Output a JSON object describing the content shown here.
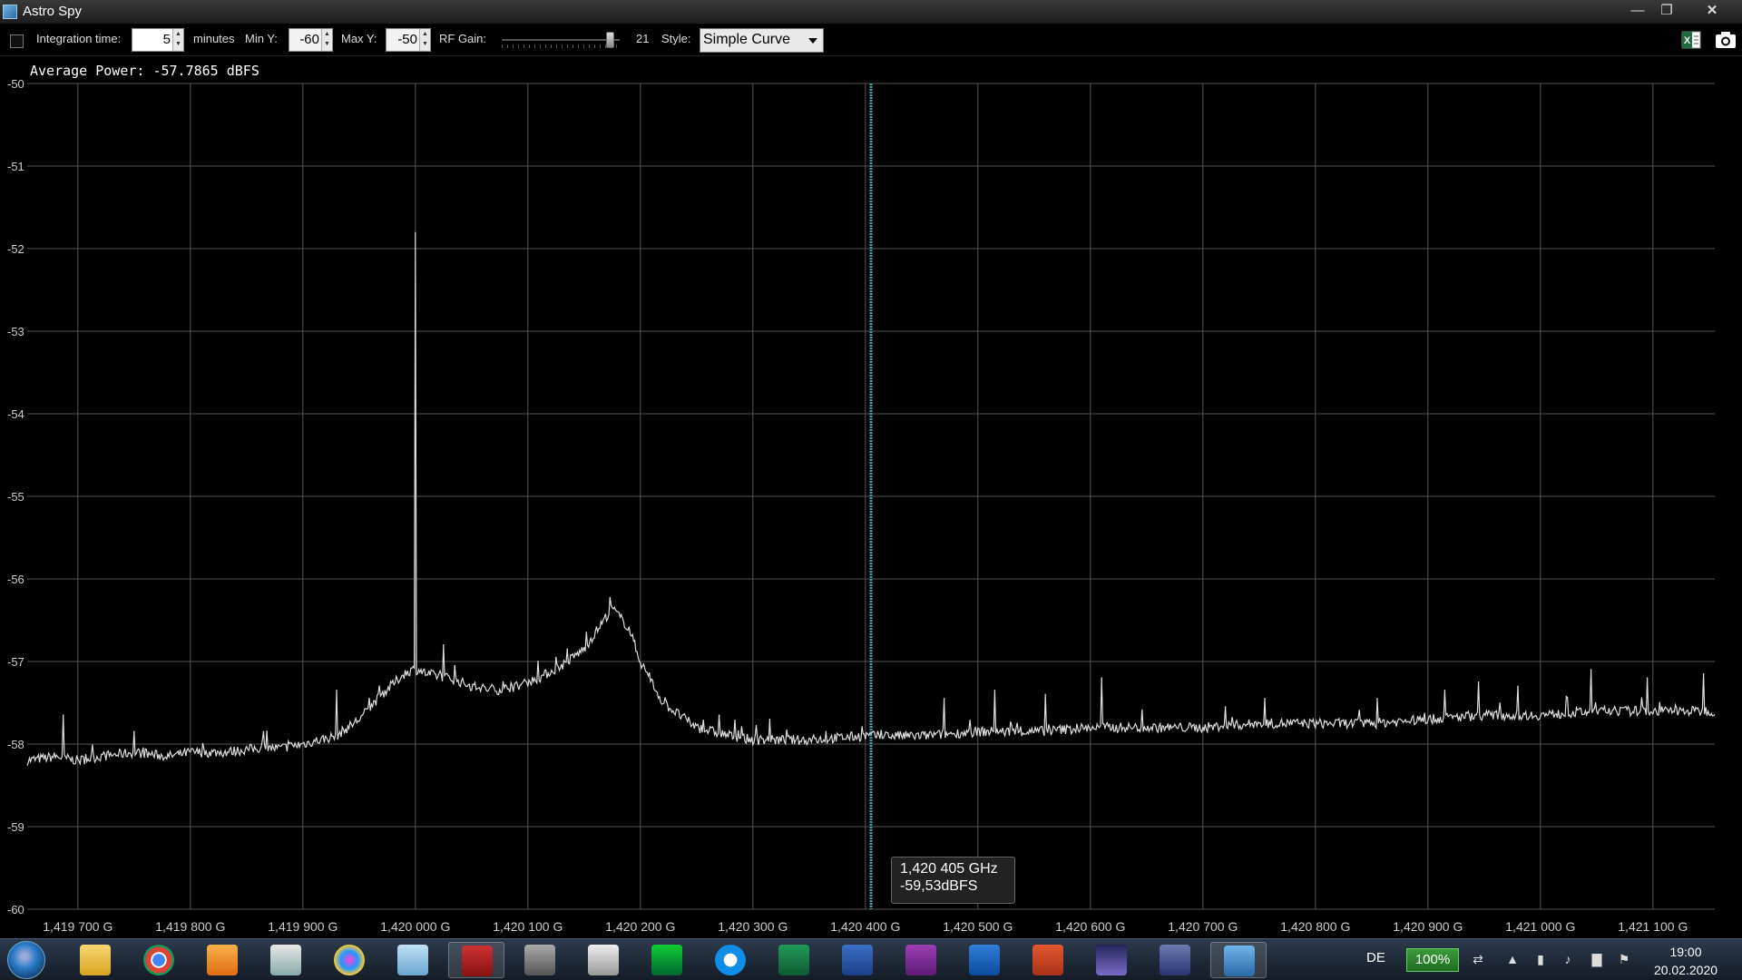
{
  "window": {
    "title": "Astro Spy"
  },
  "toolbar": {
    "integration_label": "Integration time:",
    "integration_value": "5",
    "minutes_label": "minutes",
    "min_y_label": "Min Y:",
    "min_y_value": "-60",
    "max_y_label": "Max Y:",
    "max_y_value": "-50",
    "rf_gain_label": "RF Gain:",
    "rf_gain_value": "21",
    "rf_gain_fraction": 0.95,
    "style_label": "Style:",
    "style_value": "Simple Curve"
  },
  "chart": {
    "average_power": "Average Power: -57.7865 dBFS",
    "tooltip_freq": "1,420 405 GHz",
    "tooltip_power": "-59,53dBFS"
  },
  "chart_data": {
    "type": "line",
    "title": "",
    "xlabel": "",
    "ylabel": "",
    "xlim": [
      1419.655,
      1421.155
    ],
    "ylim": [
      -60,
      -50
    ],
    "x_unit": "MHz",
    "x_ticks": [
      1419.7,
      1419.8,
      1419.9,
      1420.0,
      1420.1,
      1420.2,
      1420.3,
      1420.4,
      1420.5,
      1420.6,
      1420.7,
      1420.8,
      1420.9,
      1421.0,
      1421.1
    ],
    "x_tick_labels": [
      "1,419 700 G",
      "1,419 800 G",
      "1,419 900 G",
      "1,420 000 G",
      "1,420 100 G",
      "1,420 200 G",
      "1,420 300 G",
      "1,420 400 G",
      "1,420 500 G",
      "1,420 600 G",
      "1,420 700 G",
      "1,420 800 G",
      "1,420 900 G",
      "1,421 000 G",
      "1,421 100 G"
    ],
    "y_ticks": [
      -50,
      -51,
      -52,
      -53,
      -54,
      -55,
      -56,
      -57,
      -58,
      -59,
      -60
    ],
    "y_tick_labels": [
      "-50",
      "-51",
      "-52",
      "-53",
      "-54",
      "-55",
      "-56",
      "-57",
      "-58",
      "-59",
      "-60"
    ],
    "grid": true,
    "line_color": "#dddddd",
    "cursor_x": 1420.405,
    "cursor_color": "#2aa7a7",
    "series": [
      {
        "x": [
          1419.655,
          1419.68,
          1419.7,
          1419.72,
          1419.75,
          1419.78,
          1419.8,
          1419.83,
          1419.86,
          1419.88,
          1419.9,
          1419.93,
          1419.95,
          1419.97,
          1419.99,
          1419.997,
          1420.0,
          1420.003,
          1420.01,
          1420.03,
          1420.05,
          1420.07,
          1420.09,
          1420.11,
          1420.13,
          1420.15,
          1420.165,
          1420.175,
          1420.19,
          1420.2,
          1420.22,
          1420.25,
          1420.28,
          1420.3,
          1420.35,
          1420.4,
          1420.45,
          1420.5,
          1420.55,
          1420.6,
          1420.65,
          1420.7,
          1420.75,
          1420.8,
          1420.85,
          1420.9,
          1420.95,
          1421.0,
          1421.05,
          1421.1,
          1421.155
        ],
        "y": [
          -58.2,
          -58.15,
          -58.2,
          -58.15,
          -58.1,
          -58.15,
          -58.1,
          -58.1,
          -58.05,
          -58.05,
          -58.0,
          -57.9,
          -57.7,
          -57.4,
          -57.15,
          -57.1,
          -51.8,
          -57.1,
          -57.15,
          -57.2,
          -57.3,
          -57.35,
          -57.3,
          -57.2,
          -57.05,
          -56.85,
          -56.55,
          -56.35,
          -56.6,
          -57.0,
          -57.5,
          -57.8,
          -57.9,
          -57.95,
          -57.95,
          -57.9,
          -57.9,
          -57.85,
          -57.85,
          -57.8,
          -57.8,
          -57.8,
          -57.75,
          -57.75,
          -57.75,
          -57.7,
          -57.65,
          -57.65,
          -57.6,
          -57.6,
          -57.6
        ]
      }
    ],
    "spikes": [
      {
        "x": 1419.687,
        "y": -57.65
      },
      {
        "x": 1419.75,
        "y": -57.85
      },
      {
        "x": 1419.865,
        "y": -57.85
      },
      {
        "x": 1419.93,
        "y": -57.35
      },
      {
        "x": 1420.025,
        "y": -56.8
      },
      {
        "x": 1420.035,
        "y": -57.05
      },
      {
        "x": 1420.125,
        "y": -56.95
      },
      {
        "x": 1420.135,
        "y": -56.85
      },
      {
        "x": 1420.27,
        "y": -57.65
      },
      {
        "x": 1420.315,
        "y": -57.7
      },
      {
        "x": 1420.365,
        "y": -57.85
      },
      {
        "x": 1420.47,
        "y": -57.45
      },
      {
        "x": 1420.515,
        "y": -57.35
      },
      {
        "x": 1420.56,
        "y": -57.4
      },
      {
        "x": 1420.61,
        "y": -57.2
      },
      {
        "x": 1420.72,
        "y": -57.55
      },
      {
        "x": 1420.755,
        "y": -57.45
      },
      {
        "x": 1420.855,
        "y": -57.45
      },
      {
        "x": 1420.915,
        "y": -57.35
      },
      {
        "x": 1420.945,
        "y": -57.25
      },
      {
        "x": 1420.98,
        "y": -57.3
      },
      {
        "x": 1421.045,
        "y": -57.1
      },
      {
        "x": 1421.095,
        "y": -57.2
      },
      {
        "x": 1421.145,
        "y": -57.15
      }
    ]
  },
  "taskbar": {
    "apps": [
      "start",
      "explorer",
      "chrome",
      "media-player",
      "snipping-tool",
      "paint",
      "notepad",
      "astro-app",
      "microphone",
      "video-editor",
      "monitor",
      "teamviewer",
      "excel",
      "word",
      "onenote",
      "outlook",
      "powerpoint",
      "stellarium",
      "satellite",
      "astro-spy"
    ],
    "language": "DE",
    "battery": "100%",
    "time": "19:00",
    "date": "20.02.2020"
  }
}
